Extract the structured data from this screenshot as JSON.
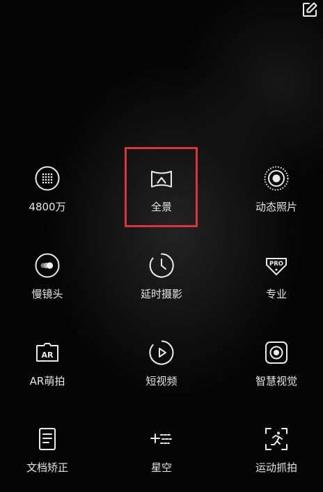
{
  "toolbar": {
    "edit_icon": "edit-icon"
  },
  "modes": [
    {
      "id": "hi-res",
      "label": "4800万",
      "icon": "grid-dots-icon"
    },
    {
      "id": "panorama",
      "label": "全景",
      "icon": "panorama-icon",
      "selected": true
    },
    {
      "id": "live-photo",
      "label": "动态照片",
      "icon": "live-photo-icon"
    },
    {
      "id": "slow-mo",
      "label": "慢镜头",
      "icon": "slow-motion-icon"
    },
    {
      "id": "time-lapse",
      "label": "延时摄影",
      "icon": "timelapse-clock-icon"
    },
    {
      "id": "pro",
      "label": "专业",
      "icon": "pro-badge-icon"
    },
    {
      "id": "ar",
      "label": "AR萌拍",
      "icon": "ar-icon"
    },
    {
      "id": "short-video",
      "label": "短视频",
      "icon": "play-circle-icon"
    },
    {
      "id": "smart-vision",
      "label": "智慧视觉",
      "icon": "smart-vision-icon"
    },
    {
      "id": "doc-scan",
      "label": "文档矫正",
      "icon": "document-icon"
    },
    {
      "id": "starry-sky",
      "label": "星空",
      "icon": "star-trail-icon"
    },
    {
      "id": "sport-capture",
      "label": "运动抓拍",
      "icon": "running-person-icon"
    }
  ],
  "colors": {
    "background": "#050505",
    "text": "#e6e6e6",
    "selection_frame": "#d9353a"
  }
}
